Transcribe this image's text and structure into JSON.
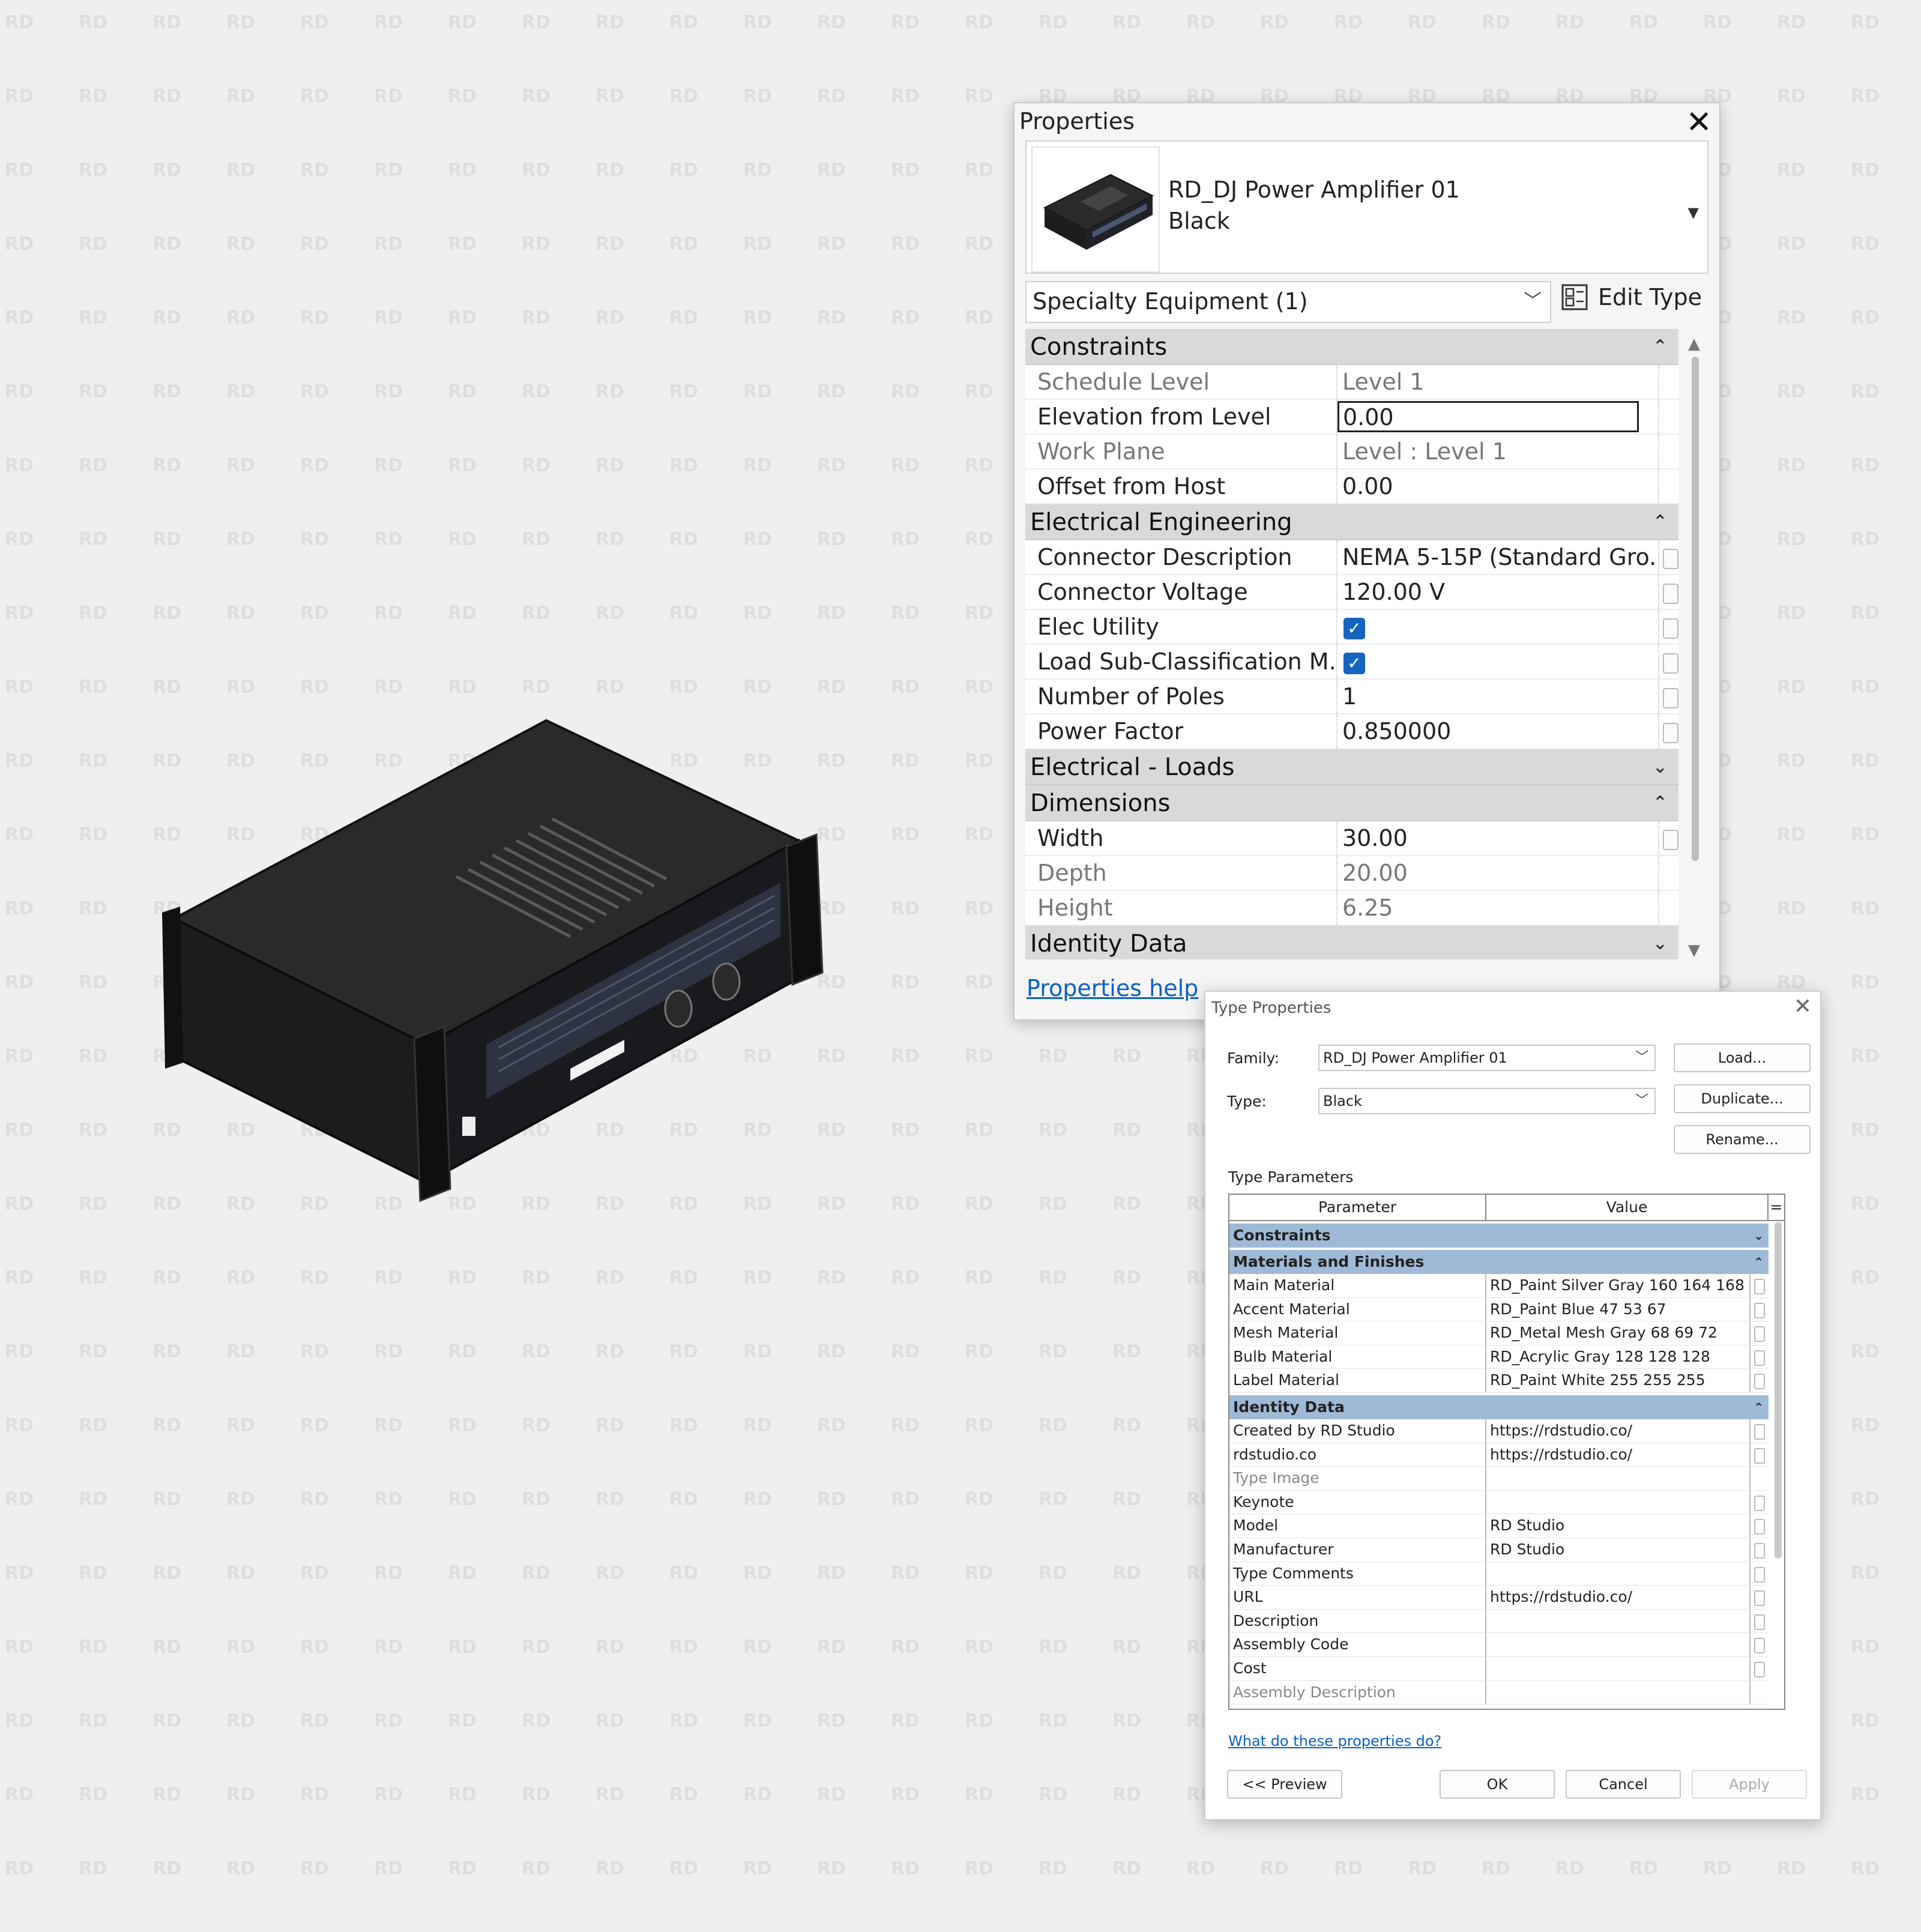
{
  "watermark": "RD",
  "properties": {
    "title": "Properties",
    "family": "RD_DJ Power Amplifier 01",
    "type": "Black",
    "category": "Specialty Equipment (1)",
    "edit_type": "Edit Type",
    "help_link": "Properties help",
    "sections": [
      {
        "name": "Constraints",
        "expanded": true,
        "rows": [
          {
            "name": "Schedule Level",
            "value": "Level 1",
            "readonly": true
          },
          {
            "name": "Elevation from Level",
            "value": "0.00",
            "editing": true
          },
          {
            "name": "Work Plane",
            "value": "Level : Level 1",
            "readonly": true
          },
          {
            "name": "Offset from Host",
            "value": "0.00"
          }
        ]
      },
      {
        "name": "Electrical Engineering",
        "expanded": true,
        "rows": [
          {
            "name": "Connector Description",
            "value": "NEMA 5-15P (Standard Gro..."
          },
          {
            "name": "Connector Voltage",
            "value": "120.00 V"
          },
          {
            "name": "Elec Utility",
            "checkbox": true
          },
          {
            "name": "Load Sub-Classification M...",
            "checkbox": true
          },
          {
            "name": "Number of Poles",
            "value": "1"
          },
          {
            "name": "Power Factor",
            "value": "0.850000"
          }
        ]
      },
      {
        "name": "Electrical - Loads",
        "expanded": false,
        "rows": []
      },
      {
        "name": "Dimensions",
        "expanded": true,
        "rows": [
          {
            "name": "Width",
            "value": "30.00"
          },
          {
            "name": "Depth",
            "value": "20.00",
            "readonly": true
          },
          {
            "name": "Height",
            "value": "6.25",
            "readonly": true
          }
        ]
      },
      {
        "name": "Identity Data",
        "expanded": false,
        "rows": []
      }
    ]
  },
  "type_properties": {
    "title": "Type Properties",
    "family_label": "Family:",
    "family_value": "RD_DJ Power Amplifier 01",
    "type_label": "Type:",
    "type_value": "Black",
    "load_button": "Load...",
    "duplicate_button": "Duplicate...",
    "rename_button": "Rename...",
    "type_parameters_label": "Type Parameters",
    "col_parameter": "Parameter",
    "col_value": "Value",
    "col_eq": "=",
    "sections": [
      {
        "name": "Constraints",
        "expanded": false,
        "rows": []
      },
      {
        "name": "Materials and Finishes",
        "expanded": true,
        "rows": [
          {
            "name": "Main Material",
            "value": "RD_Paint Silver Gray 160 164 168"
          },
          {
            "name": "Accent Material",
            "value": "RD_Paint Blue 47 53 67"
          },
          {
            "name": "Mesh Material",
            "value": "RD_Metal Mesh Gray 68 69 72"
          },
          {
            "name": "Bulb Material",
            "value": "RD_Acrylic Gray 128 128 128"
          },
          {
            "name": "Label Material",
            "value": "RD_Paint White 255 255 255"
          }
        ]
      },
      {
        "name": "Identity Data",
        "expanded": true,
        "rows": [
          {
            "name": "Created by RD Studio",
            "value": "https://rdstudio.co/"
          },
          {
            "name": "rdstudio.co",
            "value": "https://rdstudio.co/"
          },
          {
            "name": "Type Image",
            "value": "",
            "readonly": true
          },
          {
            "name": "Keynote",
            "value": ""
          },
          {
            "name": "Model",
            "value": "RD Studio"
          },
          {
            "name": "Manufacturer",
            "value": "RD Studio"
          },
          {
            "name": "Type Comments",
            "value": ""
          },
          {
            "name": "URL",
            "value": "https://rdstudio.co/"
          },
          {
            "name": "Description",
            "value": ""
          },
          {
            "name": "Assembly Code",
            "value": ""
          },
          {
            "name": "Cost",
            "value": ""
          },
          {
            "name": "Assembly Description",
            "value": "",
            "readonly": true
          }
        ]
      }
    ],
    "help_link": "What do these properties do?",
    "preview_button": "<< Preview",
    "ok_button": "OK",
    "cancel_button": "Cancel",
    "apply_button": "Apply"
  },
  "icons": {
    "collapse": "double-chevron-up-icon",
    "expand": "double-chevron-down-icon",
    "close": "close-icon",
    "dropdown": "chevron-down-icon",
    "edit_type": "edit-type-icon",
    "check": "checkbox-checked-icon"
  },
  "colors": {
    "accent_blue": "#1565c0",
    "link_blue": "#0b61c4",
    "section_gray": "#d9d9d9",
    "type_section_blue": "#9fbad6",
    "product_accent": "#2f3543"
  }
}
